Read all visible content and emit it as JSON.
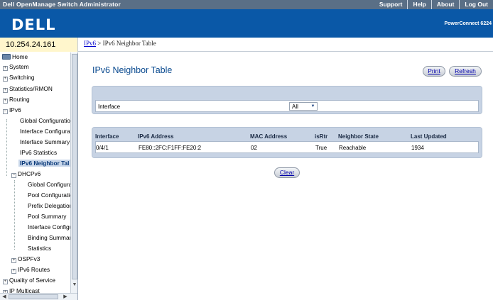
{
  "topbar": {
    "title": "Dell OpenManage Switch Administrator",
    "links": [
      "Support",
      "Help",
      "About",
      "Log Out"
    ]
  },
  "brand": {
    "logo": "DELL",
    "product": "PowerConnect 6224"
  },
  "ip_address": "10.254.24.161",
  "breadcrumb": {
    "parent": "IPv6",
    "separator": " > ",
    "current": "IPv6 Neighbor Table"
  },
  "nav": {
    "home": "Home",
    "system": "System",
    "switching": "Switching",
    "statistics_rmon": "Statistics/RMON",
    "routing": "Routing",
    "ipv6": "IPv6",
    "global_configuration": "Global Configuratior",
    "interface_configuration": "Interface Configurat",
    "interface_summary": "Interface Summary",
    "ipv6_statistics": "IPv6 Statistics",
    "ipv6_neighbor_table": "IPv6 Neighbor Tal",
    "dhcpv6": "DHCPv6",
    "dhcp_global_configuration": "Global Configura",
    "pool_configuration": "Pool Configuratic",
    "prefix_delegation": "Prefix Delegatior",
    "pool_summary": "Pool Summary",
    "dhcp_interface_configuration": "Interface Configu",
    "binding_summary": "Binding Summar",
    "dhcp_statistics": "Statistics",
    "ospfv3": "OSPFv3",
    "ipv6_routes": "IPv6 Routes",
    "quality_of_service": "Quality of Service",
    "ip_multicast": "IP Multicast"
  },
  "page": {
    "title": "IPv6 Neighbor Table",
    "print_label": "Print",
    "refresh_label": "Refresh",
    "clear_label": "Clear"
  },
  "filter": {
    "label": "Interface",
    "selected": "All"
  },
  "table": {
    "headers": {
      "interface": "Interface",
      "ipv6_address": "IPv6 Address",
      "mac_address": "MAC Address",
      "is_rtr": "isRtr",
      "neighbor_state": "Neighbor State",
      "last_updated": "Last Updated"
    },
    "rows": [
      {
        "interface": "0/4/1",
        "ipv6_address": "FE80::2FC:F1FF:FE20:2",
        "mac_address": "02",
        "is_rtr": "True",
        "neighbor_state": "Reachable",
        "last_updated": "1934"
      }
    ]
  },
  "colors": {
    "topbar": "#5a6f86",
    "brand_blue": "#0a58a7",
    "panel_blue": "#c7d3e4",
    "title_blue": "#0a4a8f",
    "ip_highlight": "#fff6cc"
  }
}
